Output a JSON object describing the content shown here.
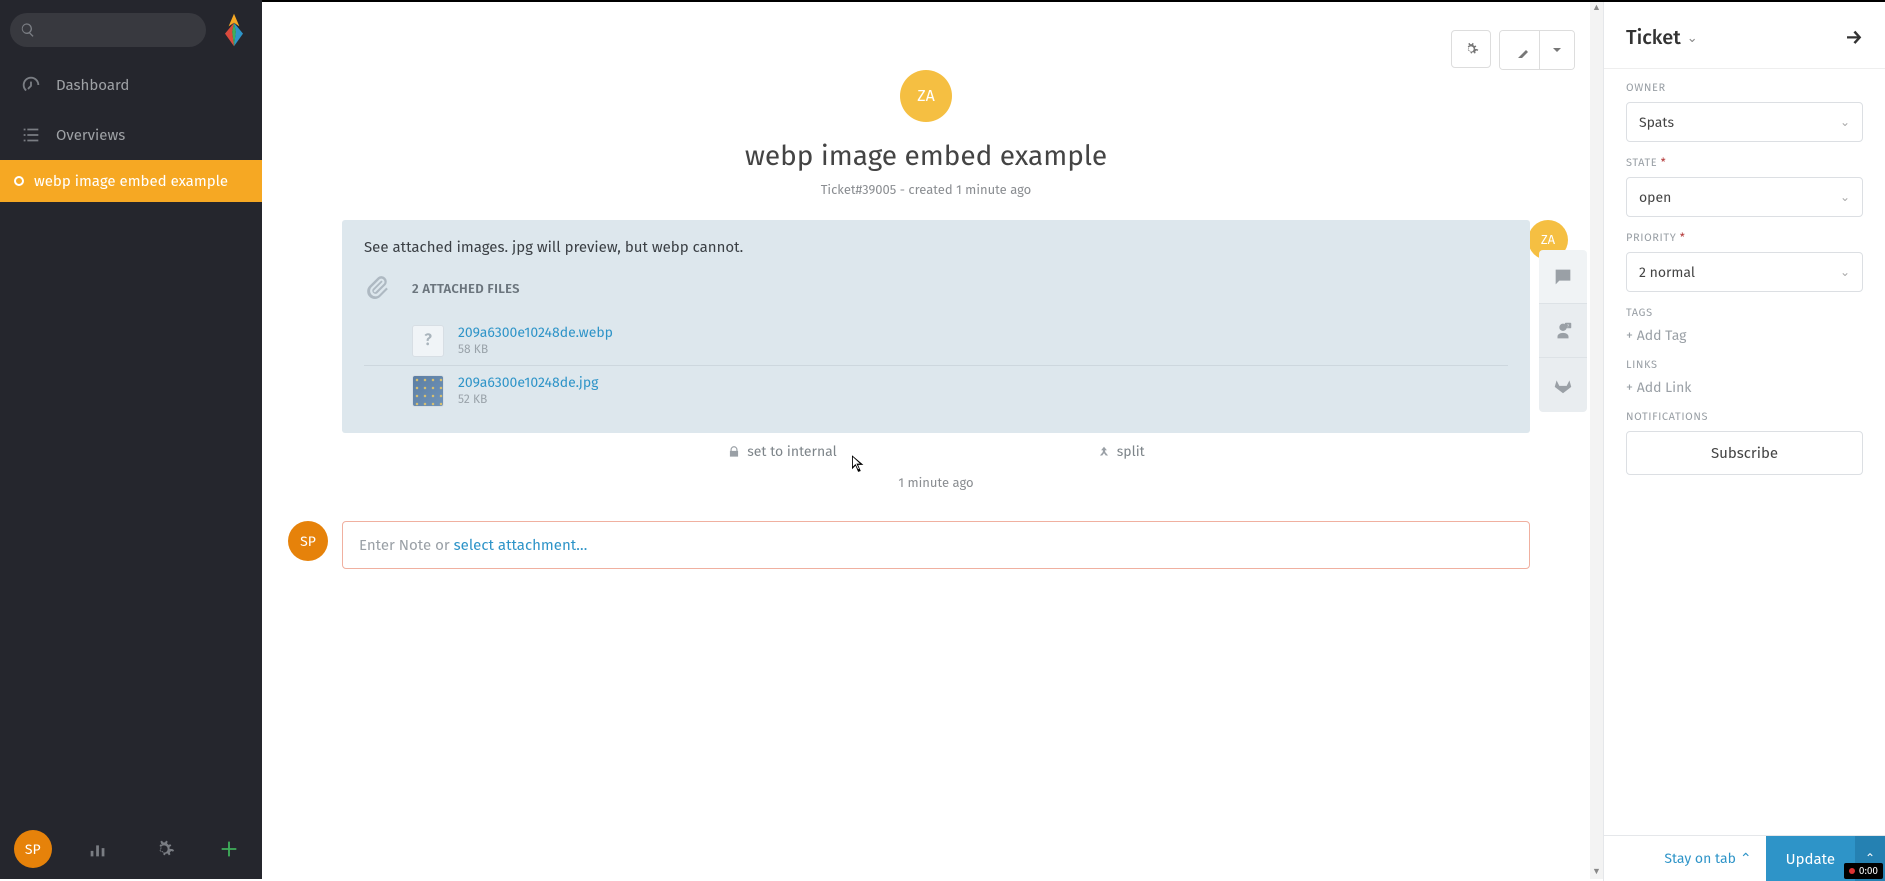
{
  "sidebar": {
    "dashboard": "Dashboard",
    "overviews": "Overviews",
    "ticket_item": "webp image embed example",
    "user_initials": "SP"
  },
  "header": {
    "avatar": "ZA",
    "title": "webp image embed example",
    "meta": "Ticket#39005 - created 1 minute ago"
  },
  "article": {
    "avatar": "ZA",
    "text": "See attached images.  jpg will preview, but webp cannot.",
    "attach_count": "2 ATTACHED FILES",
    "files": [
      {
        "name": "209a6300e10248de.webp",
        "size": "58 KB",
        "thumb": "?"
      },
      {
        "name": "209a6300e10248de.jpg",
        "size": "52 KB",
        "thumb": "img"
      }
    ],
    "set_internal": "set to internal",
    "split": "split",
    "timestamp": "1 minute ago"
  },
  "reply": {
    "avatar": "SP",
    "placeholder_prefix": "Enter Note or ",
    "placeholder_link": "select attachment…"
  },
  "panel": {
    "title": "Ticket",
    "owner_label": "OWNER",
    "owner_value": "Spats",
    "state_label": "STATE",
    "state_value": "open",
    "priority_label": "PRIORITY",
    "priority_value": "2 normal",
    "tags_label": "TAGS",
    "add_tag": "+ Add Tag",
    "links_label": "LINKS",
    "add_link": "+ Add Link",
    "notifications_label": "NOTIFICATIONS",
    "subscribe": "Subscribe",
    "stay_on_tab": "Stay on tab",
    "update": "Update"
  },
  "rec_time": "0:00"
}
